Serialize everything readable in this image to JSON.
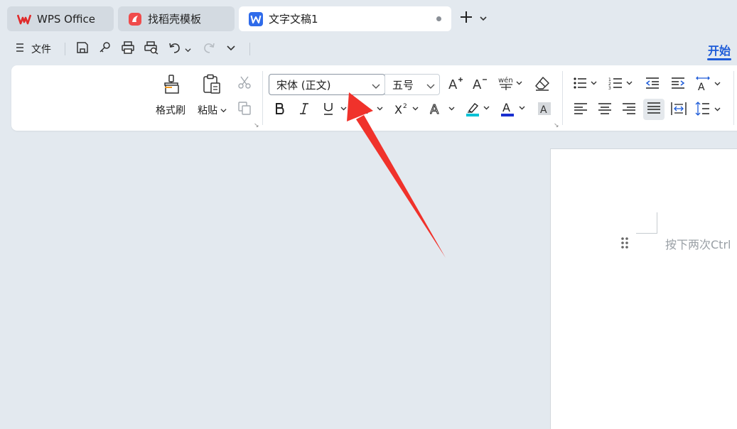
{
  "tabs": [
    {
      "label": "WPS Office"
    },
    {
      "label": "找稻壳模板"
    },
    {
      "label": "文字文稿1"
    }
  ],
  "quickbar": {
    "file_label": "文件",
    "start_tab": "开始"
  },
  "ribbon": {
    "format_painter_label": "格式刷",
    "paste_label": "粘贴",
    "font_name": "宋体 (正文)",
    "font_size": "五号"
  },
  "document": {
    "hint": "按下两次Ctrl"
  },
  "colors": {
    "accent": "#1d5bd8",
    "arrow": "#f0322b",
    "highlight": "#00c2d6",
    "font_color": "#1a2fd0"
  }
}
